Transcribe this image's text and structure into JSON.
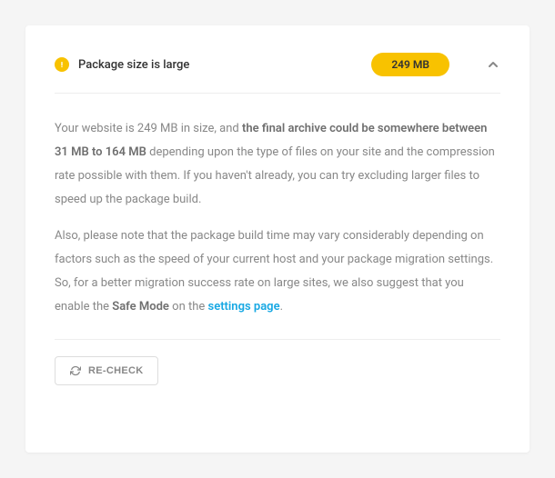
{
  "header": {
    "title": "Package size is large",
    "size_badge": "249 MB"
  },
  "body": {
    "p1_prefix": "Your website is 249 MB in size, and ",
    "p1_bold": "the final archive could be somewhere between 31 MB to 164 MB",
    "p1_suffix": " depending upon the type of files on your site and the compression rate possible with them. If you haven't already, you can try excluding larger files to speed up the package build.",
    "p2_prefix": "Also, please note that the package build time may vary considerably depending on factors such as the speed of your current host and your package migration settings. So, for a better migration success rate on large sites, we also suggest that you enable the ",
    "p2_bold": "Safe Mode",
    "p2_mid": " on the ",
    "p2_link": "settings page",
    "p2_suffix": "."
  },
  "footer": {
    "recheck_label": "RE-CHECK"
  }
}
